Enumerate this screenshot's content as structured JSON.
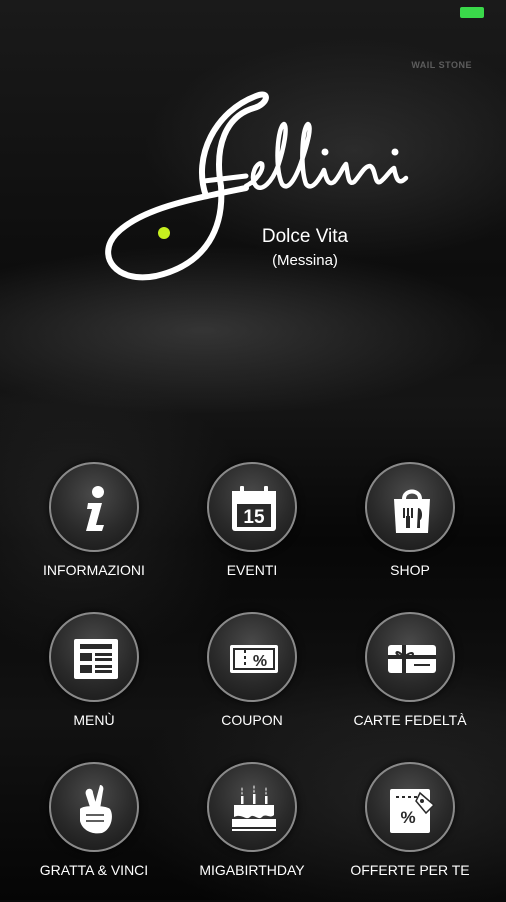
{
  "brand": {
    "subtitle": "Dolce Vita",
    "location": "(Messina)",
    "watermark": "WAIL STONE"
  },
  "colors": {
    "battery": "#3ad94a",
    "dot": "#c6f01f"
  },
  "menu": [
    {
      "label": "INFORMAZIONI",
      "icon": "info-icon"
    },
    {
      "label": "EVENTI",
      "icon": "calendar-icon",
      "icon_text": "15"
    },
    {
      "label": "SHOP",
      "icon": "shopping-bag-icon"
    },
    {
      "label": "MENÙ",
      "icon": "menu-list-icon"
    },
    {
      "label": "COUPON",
      "icon": "coupon-icon",
      "icon_text": "%"
    },
    {
      "label": "CARTE FEDELTÀ",
      "icon": "gift-card-icon"
    },
    {
      "label": "GRATTA & VINCI",
      "icon": "crossed-fingers-icon"
    },
    {
      "label": "MIGABIRTHDAY",
      "icon": "birthday-cake-icon"
    },
    {
      "label": "OFFERTE PER TE",
      "icon": "offer-tag-icon",
      "icon_text": "%"
    }
  ]
}
